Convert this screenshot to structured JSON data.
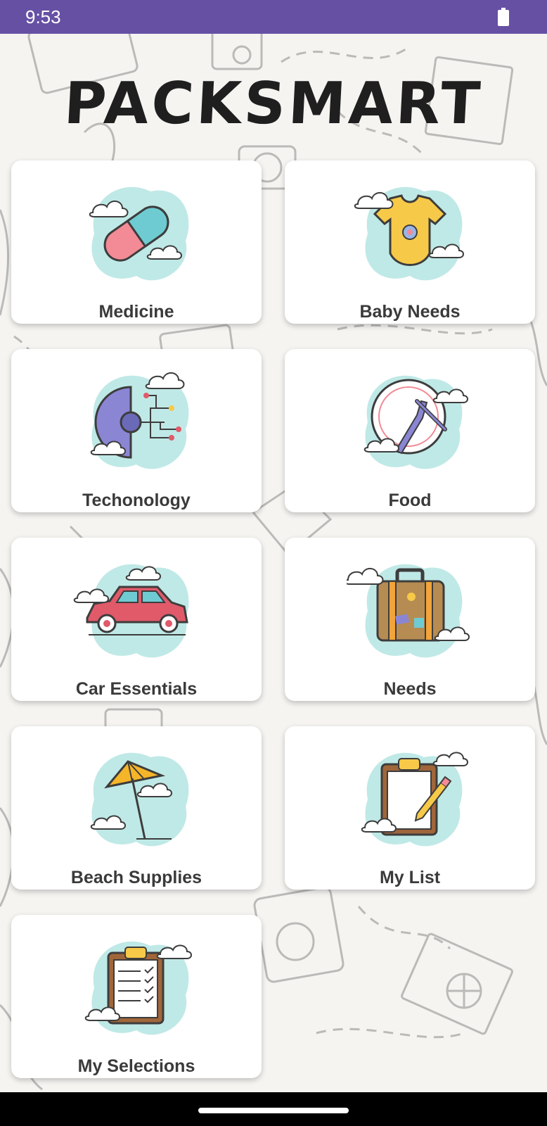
{
  "status_bar": {
    "time": "9:53",
    "battery_icon": "battery-full-icon"
  },
  "app": {
    "title": "PACKSMART"
  },
  "categories": [
    {
      "label": "Medicine",
      "icon": "medicine-capsule-icon"
    },
    {
      "label": "Baby Needs",
      "icon": "baby-onesie-icon"
    },
    {
      "label": "Techonology",
      "icon": "technology-gear-circuit-icon"
    },
    {
      "label": "Food",
      "icon": "food-plate-cutlery-icon"
    },
    {
      "label": "Car Essentials",
      "icon": "car-icon"
    },
    {
      "label": "Needs",
      "icon": "suitcase-icon"
    },
    {
      "label": "Beach Supplies",
      "icon": "beach-umbrella-icon"
    },
    {
      "label": "My List",
      "icon": "clipboard-pencil-icon"
    },
    {
      "label": "My Selections",
      "icon": "clipboard-checklist-icon"
    }
  ],
  "colors": {
    "status_bar": "#6650a4",
    "cloud_bg": "#bfe9e6",
    "card_bg": "#ffffff",
    "label_text": "#3a3a3a",
    "background": "#f5f4f1"
  }
}
